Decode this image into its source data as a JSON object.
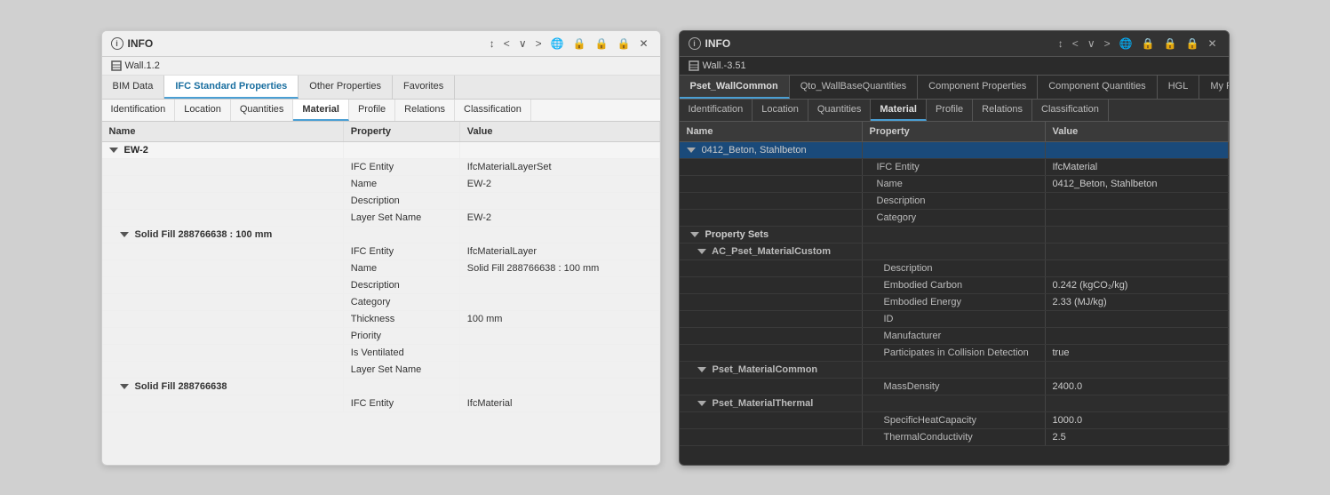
{
  "left_panel": {
    "title": "INFO",
    "wall_label": "Wall.1.2",
    "tabs": [
      {
        "id": "bim-data",
        "label": "BIM Data",
        "active": false
      },
      {
        "id": "ifc-standard",
        "label": "IFC Standard Properties",
        "active": true
      },
      {
        "id": "other-properties",
        "label": "Other Properties",
        "active": false
      },
      {
        "id": "favorites",
        "label": "Favorites",
        "active": false
      }
    ],
    "subtabs": [
      {
        "id": "identification",
        "label": "Identification",
        "active": false
      },
      {
        "id": "location",
        "label": "Location",
        "active": false
      },
      {
        "id": "quantities",
        "label": "Quantities",
        "active": false
      },
      {
        "id": "material",
        "label": "Material",
        "active": true
      },
      {
        "id": "profile",
        "label": "Profile",
        "active": false
      },
      {
        "id": "relations",
        "label": "Relations",
        "active": false
      },
      {
        "id": "classification",
        "label": "Classification",
        "active": false
      }
    ],
    "table_headers": [
      "Name",
      "Property",
      "Value"
    ],
    "controls": [
      "↕",
      "<",
      "∨",
      ">",
      "🌐",
      "🔒",
      "🔒",
      "🔒",
      "✕"
    ],
    "rows": [
      {
        "type": "group",
        "name": "EW-2",
        "property": "",
        "value": "",
        "indent": 0
      },
      {
        "type": "data",
        "name": "",
        "property": "IFC Entity",
        "value": "IfcMaterialLayerSet",
        "indent": 0
      },
      {
        "type": "data",
        "name": "",
        "property": "Name",
        "value": "EW-2",
        "indent": 0
      },
      {
        "type": "data",
        "name": "",
        "property": "Description",
        "value": "",
        "indent": 0
      },
      {
        "type": "data",
        "name": "",
        "property": "Layer Set Name",
        "value": "EW-2",
        "indent": 0
      },
      {
        "type": "subgroup",
        "name": "Solid Fill 288766638 : 100 mm",
        "property": "",
        "value": "",
        "indent": 1
      },
      {
        "type": "data",
        "name": "",
        "property": "IFC Entity",
        "value": "IfcMaterialLayer",
        "indent": 1
      },
      {
        "type": "data",
        "name": "",
        "property": "Name",
        "value": "Solid Fill 288766638 : 100 mm",
        "indent": 1
      },
      {
        "type": "data",
        "name": "",
        "property": "Description",
        "value": "",
        "indent": 1
      },
      {
        "type": "data",
        "name": "",
        "property": "Category",
        "value": "",
        "indent": 1
      },
      {
        "type": "data",
        "name": "",
        "property": "Thickness",
        "value": "100 mm",
        "indent": 1
      },
      {
        "type": "data",
        "name": "",
        "property": "Priority",
        "value": "",
        "indent": 1
      },
      {
        "type": "data",
        "name": "",
        "property": "Is Ventilated",
        "value": "",
        "indent": 1
      },
      {
        "type": "data",
        "name": "",
        "property": "Layer Set Name",
        "value": "",
        "indent": 1
      },
      {
        "type": "subgroup",
        "name": "Solid Fill 288766638",
        "property": "",
        "value": "",
        "indent": 1
      },
      {
        "type": "data",
        "name": "",
        "property": "IFC Entity",
        "value": "IfcMaterial",
        "indent": 1
      }
    ]
  },
  "right_panel": {
    "title": "INFO",
    "wall_label": "Wall.-3.51",
    "tabs": [
      {
        "id": "pset-wallcommon",
        "label": "Pset_WallCommon",
        "active": true
      },
      {
        "id": "qto-wallbase",
        "label": "Qto_WallBaseQuantities",
        "active": false
      },
      {
        "id": "component-properties",
        "label": "Component Properties",
        "active": false
      },
      {
        "id": "component-quantities",
        "label": "Component Quantities",
        "active": false
      },
      {
        "id": "hgl",
        "label": "HGL",
        "active": false
      },
      {
        "id": "my-favorites",
        "label": "My Favorites",
        "active": false
      }
    ],
    "subtabs": [
      {
        "id": "identification",
        "label": "Identification",
        "active": false
      },
      {
        "id": "location",
        "label": "Location",
        "active": false
      },
      {
        "id": "quantities",
        "label": "Quantities",
        "active": false
      },
      {
        "id": "material",
        "label": "Material",
        "active": true
      },
      {
        "id": "profile",
        "label": "Profile",
        "active": false
      },
      {
        "id": "relations",
        "label": "Relations",
        "active": false
      },
      {
        "id": "classification",
        "label": "Classification",
        "active": false
      }
    ],
    "table_headers": [
      "Name",
      "Property",
      "Value"
    ],
    "controls": [
      "↕",
      "<",
      "∨",
      ">",
      "🌐",
      "🔒",
      "🔒",
      "🔒",
      "✕"
    ],
    "selected_group": "0412_Beton, Stahlbeton",
    "rows": [
      {
        "type": "group",
        "name": "0412_Beton, Stahlbeton",
        "property": "",
        "value": "",
        "selected": true
      },
      {
        "type": "data",
        "col2": "IFC Entity",
        "col3": "IfcMaterial"
      },
      {
        "type": "data",
        "col2": "Name",
        "col3": "0412_Beton, Stahlbeton"
      },
      {
        "type": "data",
        "col2": "Description",
        "col3": ""
      },
      {
        "type": "data",
        "col2": "Category",
        "col3": ""
      },
      {
        "type": "subgroup",
        "name": "Property Sets"
      },
      {
        "type": "subgroup2",
        "name": "AC_Pset_MaterialCustom"
      },
      {
        "type": "data",
        "col2": "Description",
        "col3": ""
      },
      {
        "type": "data",
        "col2": "Embodied Carbon",
        "col3": "0.242 (kgCO₂/kg)"
      },
      {
        "type": "data",
        "col2": "Embodied Energy",
        "col3": "2.33 (MJ/kg)"
      },
      {
        "type": "data",
        "col2": "ID",
        "col3": ""
      },
      {
        "type": "data",
        "col2": "Manufacturer",
        "col3": ""
      },
      {
        "type": "data",
        "col2": "Participates in Collision Detection",
        "col3": "true"
      },
      {
        "type": "subgroup2",
        "name": "Pset_MaterialCommon"
      },
      {
        "type": "data",
        "col2": "MassDensity",
        "col3": "2400.0"
      },
      {
        "type": "subgroup2",
        "name": "Pset_MaterialThermal"
      },
      {
        "type": "data",
        "col2": "SpecificHeatCapacity",
        "col3": "1000.0"
      },
      {
        "type": "data",
        "col2": "ThermalConductivity",
        "col3": "2.5"
      }
    ]
  }
}
